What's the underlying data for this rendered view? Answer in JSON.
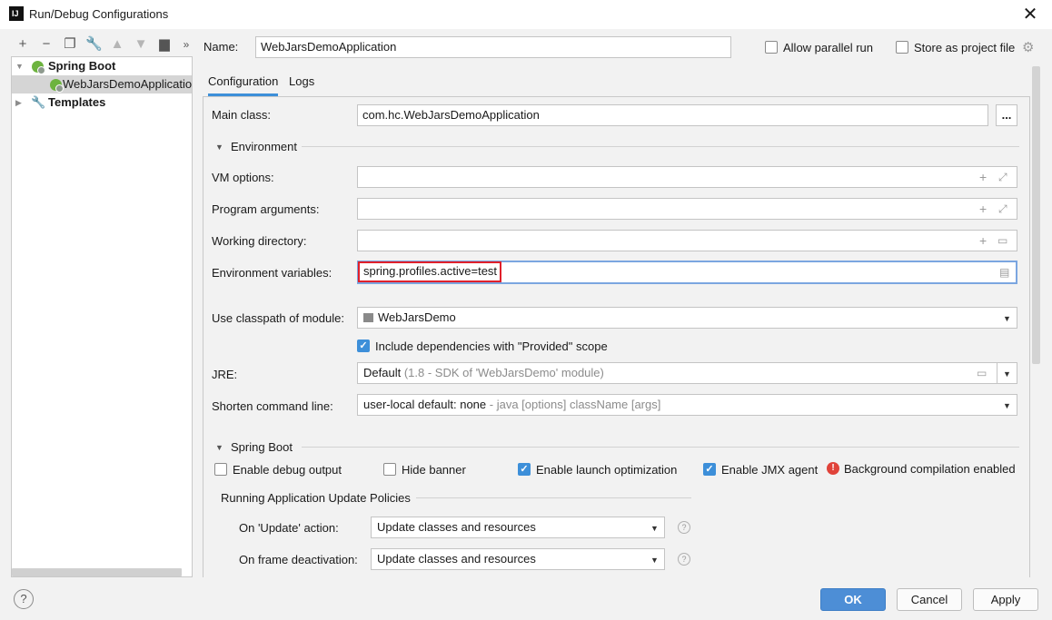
{
  "window": {
    "title": "Run/Debug Configurations",
    "app_icon": "IJ"
  },
  "toolbar": {
    "icons": [
      "add-icon",
      "remove-icon",
      "copy-icon",
      "wrench-icon",
      "arrow-up-icon",
      "arrow-down-icon",
      "folder-add-icon",
      "more-icon"
    ]
  },
  "tree": {
    "spring_boot": "Spring Boot",
    "app_item": "WebJarsDemoApplication",
    "templates": "Templates"
  },
  "header": {
    "name_label": "Name:",
    "name_value": "WebJarsDemoApplication",
    "allow_parallel": "Allow parallel run",
    "store_as_file": "Store as project file"
  },
  "tabs": {
    "configuration": "Configuration",
    "logs": "Logs"
  },
  "config": {
    "main_class_label": "Main class:",
    "main_class_value": "com.hc.WebJarsDemoApplication",
    "browse_label": "...",
    "environment_section": "Environment",
    "vm_options_label": "VM options:",
    "program_args_label": "Program arguments:",
    "working_dir_label": "Working directory:",
    "env_vars_label": "Environment variables:",
    "env_vars_value": "spring.profiles.active=test",
    "classpath_label": "Use classpath of module:",
    "classpath_value": "WebJarsDemo",
    "include_deps_label": "Include dependencies with \"Provided\" scope",
    "jre_label": "JRE:",
    "jre_value": "Default",
    "jre_hint": "(1.8 - SDK of 'WebJarsDemo' module)",
    "shorten_label": "Shorten command line:",
    "shorten_value": "user-local default: none",
    "shorten_hint": "- java [options] className [args]"
  },
  "spring_boot": {
    "section": "Spring Boot",
    "debug_output": "Enable debug output",
    "hide_banner": "Hide banner",
    "launch_opt": "Enable launch optimization",
    "jmx_agent": "Enable JMX agent",
    "bg_compilation": "Background compilation enabled",
    "policies_title": "Running Application Update Policies",
    "on_update_label": "On 'Update' action:",
    "on_update_value": "Update classes and resources",
    "on_deactivation_label": "On frame deactivation:",
    "on_deactivation_value": "Update classes and resources"
  },
  "footer": {
    "help": "?",
    "ok": "OK",
    "cancel": "Cancel",
    "apply": "Apply"
  },
  "colors": {
    "accent": "#3d8fd9",
    "primary_button": "#4d8ed6",
    "highlight_border": "#e0202b",
    "spring_green": "#6db33f"
  }
}
